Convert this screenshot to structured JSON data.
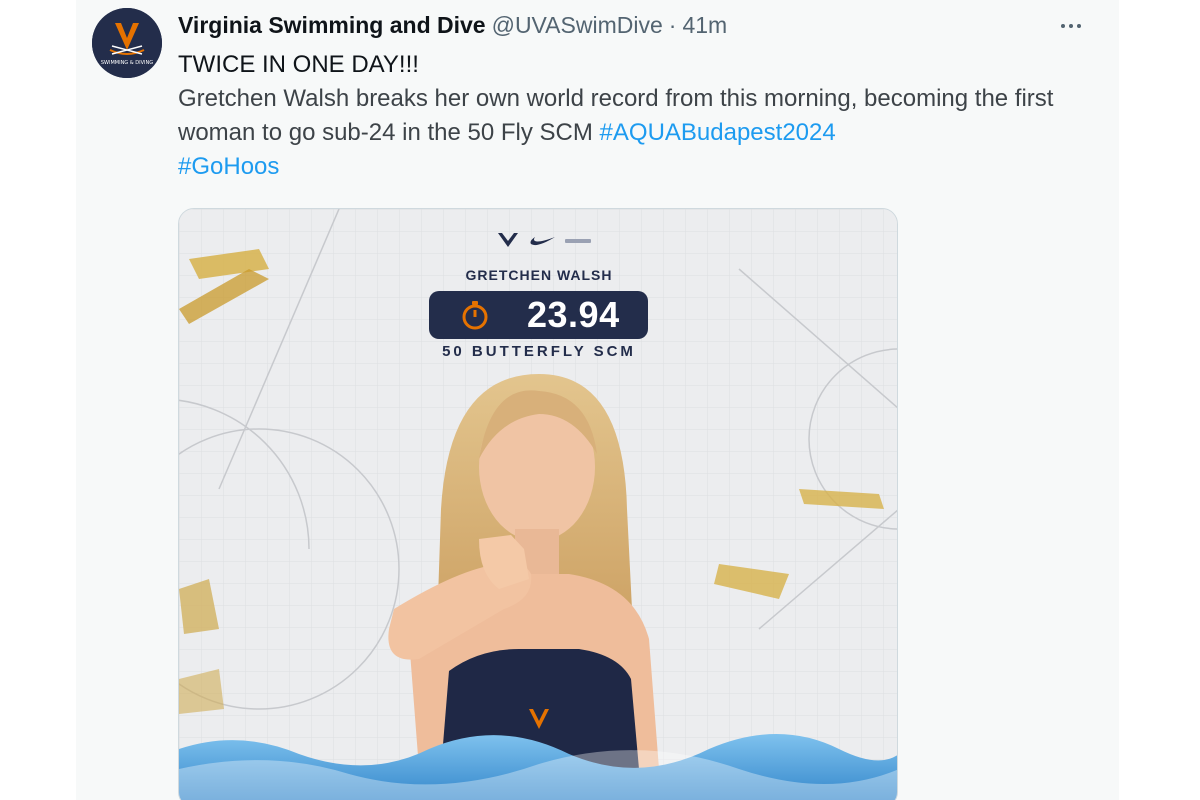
{
  "tweet": {
    "display_name": "Virginia Swimming and Dive",
    "handle": "@UVASwimDive",
    "separator": "·",
    "time": "41m",
    "headline": "TWICE IN ONE DAY!!!",
    "body": "Gretchen Walsh breaks her own world record from this morning, becoming the first woman to go sub-24 in the 50 Fly SCM",
    "hashtags": [
      "#AQUABudapest2024",
      "#GoHoos"
    ],
    "avatar_text": "SWIMMING & DIVING"
  },
  "media": {
    "athlete_name": "GRETCHEN WALSH",
    "result_time": "23.94",
    "event": "50 BUTTERFLY SCM",
    "icons": [
      "uva-logo-icon",
      "nike-swoosh-icon",
      "stopwatch-icon"
    ]
  },
  "colors": {
    "navy": "#232d4b",
    "orange": "#e57200",
    "link_blue": "#1d9bf0",
    "muted_text": "#536471"
  }
}
